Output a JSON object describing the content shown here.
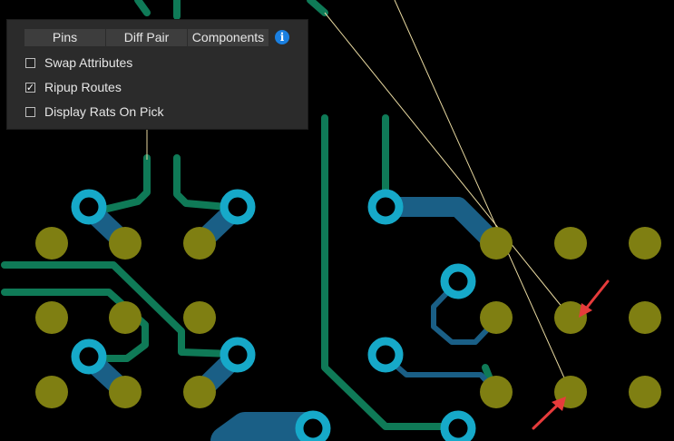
{
  "panel": {
    "tabs": [
      {
        "label": "Pins",
        "active": true
      },
      {
        "label": "Diff Pair",
        "active": false
      },
      {
        "label": "Components",
        "active": false
      }
    ],
    "info_icon": "info-icon",
    "options": [
      {
        "label": "Swap Attributes",
        "checked": false
      },
      {
        "label": "Ripup Routes",
        "checked": true
      },
      {
        "label": "Display Rats On Pick",
        "checked": false
      }
    ],
    "check_glyph": "✓"
  },
  "colors": {
    "background": "#000000",
    "trace_green": "#0f7a57",
    "trace_blue": "#1a5f86",
    "via_cyan": "#16a9c9",
    "pad_olive": "#7f7f12",
    "ratsnest": "#e8d9a0",
    "annotation_arrow": "#e63b3b",
    "tab_active": "#1a7fe0"
  }
}
